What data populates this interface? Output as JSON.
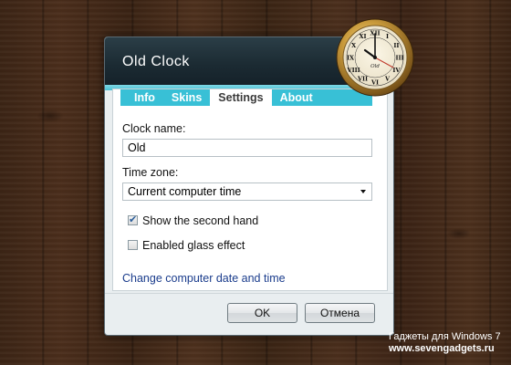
{
  "window": {
    "title": "Old  Clock"
  },
  "tabs": [
    {
      "label": "Info",
      "active": false
    },
    {
      "label": "Skins",
      "active": false
    },
    {
      "label": "Settings",
      "active": true
    },
    {
      "label": "About",
      "active": false
    }
  ],
  "form": {
    "clock_name_label": "Clock name:",
    "clock_name_value": "Old",
    "time_zone_label": "Time zone:",
    "time_zone_value": "Current computer time",
    "show_second_hand_label": "Show the second hand",
    "show_second_hand_checked": true,
    "glass_effect_label": "Enabled glass effect",
    "glass_effect_checked": false,
    "change_date_link": "Change computer date and time"
  },
  "buttons": {
    "ok": "OK",
    "cancel": "Отмена"
  },
  "clock": {
    "brand_text": "Old",
    "numerals": [
      "XII",
      "I",
      "II",
      "III",
      "IV",
      "V",
      "VI",
      "VII",
      "VIII",
      "IX",
      "X",
      "XI"
    ]
  },
  "watermark": {
    "line1": "Гаджеты для Windows 7",
    "line2": "www.sevengadgets.ru"
  },
  "colors": {
    "title_bar": "#1b2a32",
    "tab_strip": "#38c0d6",
    "link": "#1a3c8c"
  }
}
